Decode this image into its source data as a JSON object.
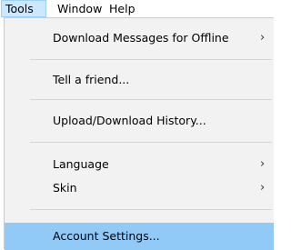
{
  "menubar": {
    "items": [
      "Tools",
      "Window",
      "Help"
    ]
  },
  "tools_menu": {
    "items": [
      {
        "label": "Download Messages for Offline",
        "submenu_icon": "chevron-right-icon",
        "chevron": "›"
      },
      {
        "label": "Tell a friend..."
      },
      {
        "label": "Upload/Download History..."
      },
      {
        "label": "Language",
        "submenu_icon": "chevron-right-icon",
        "chevron": "›"
      },
      {
        "label": "Skin",
        "submenu_icon": "chevron-right-icon",
        "chevron": "›"
      },
      {
        "label": "Account Settings...",
        "highlighted": true
      }
    ]
  },
  "colors": {
    "menu_background": "#f2f2f2",
    "open_menu_highlight": "#cce8ff",
    "selected_item": "#91c9f7",
    "separator": "#d4d4d4"
  }
}
